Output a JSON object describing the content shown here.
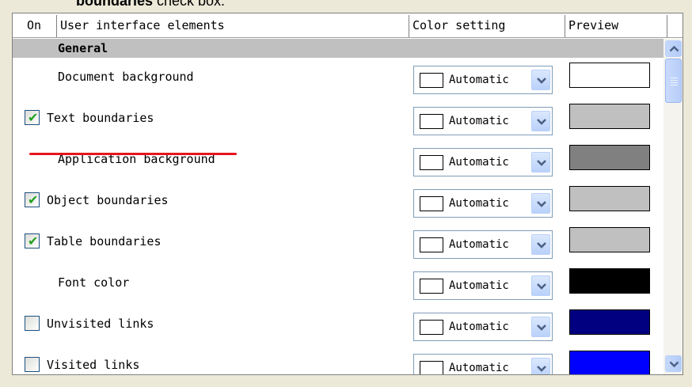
{
  "caption": {
    "bold_text": "boundaries",
    "text": " check box."
  },
  "header": {
    "on": "On",
    "elements": "User interface elements",
    "color": "Color setting",
    "preview": "Preview"
  },
  "group": {
    "label": "General"
  },
  "rows": [
    {
      "label": "Document background",
      "checkbox": false,
      "checked": false,
      "color_value": "Automatic",
      "preview_color": "#ffffff"
    },
    {
      "label": "Text boundaries",
      "checkbox": true,
      "checked": true,
      "color_value": "Automatic",
      "preview_color": "#c0c0c0"
    },
    {
      "label": "Application background",
      "checkbox": false,
      "checked": false,
      "color_value": "Automatic",
      "preview_color": "#808080"
    },
    {
      "label": "Object boundaries",
      "checkbox": true,
      "checked": true,
      "color_value": "Automatic",
      "preview_color": "#c0c0c0"
    },
    {
      "label": "Table boundaries",
      "checkbox": true,
      "checked": true,
      "color_value": "Automatic",
      "preview_color": "#c0c0c0"
    },
    {
      "label": "Font color",
      "checkbox": false,
      "checked": false,
      "color_value": "Automatic",
      "preview_color": "#000000"
    },
    {
      "label": "Unvisited links",
      "checkbox": true,
      "checked": false,
      "color_value": "Automatic",
      "preview_color": "#000080"
    },
    {
      "label": "Visited links",
      "checkbox": true,
      "checked": false,
      "color_value": "Automatic",
      "preview_color": "#0000ff"
    }
  ],
  "icons": {
    "checkmark": "checkmark-icon",
    "dropdown": "chevron-down-icon",
    "scroll_up": "scroll-up-icon",
    "scroll_down": "scroll-down-icon"
  },
  "colors": {
    "annotation_underline": "#e8141c",
    "accent_button": "#b9d1fa"
  }
}
